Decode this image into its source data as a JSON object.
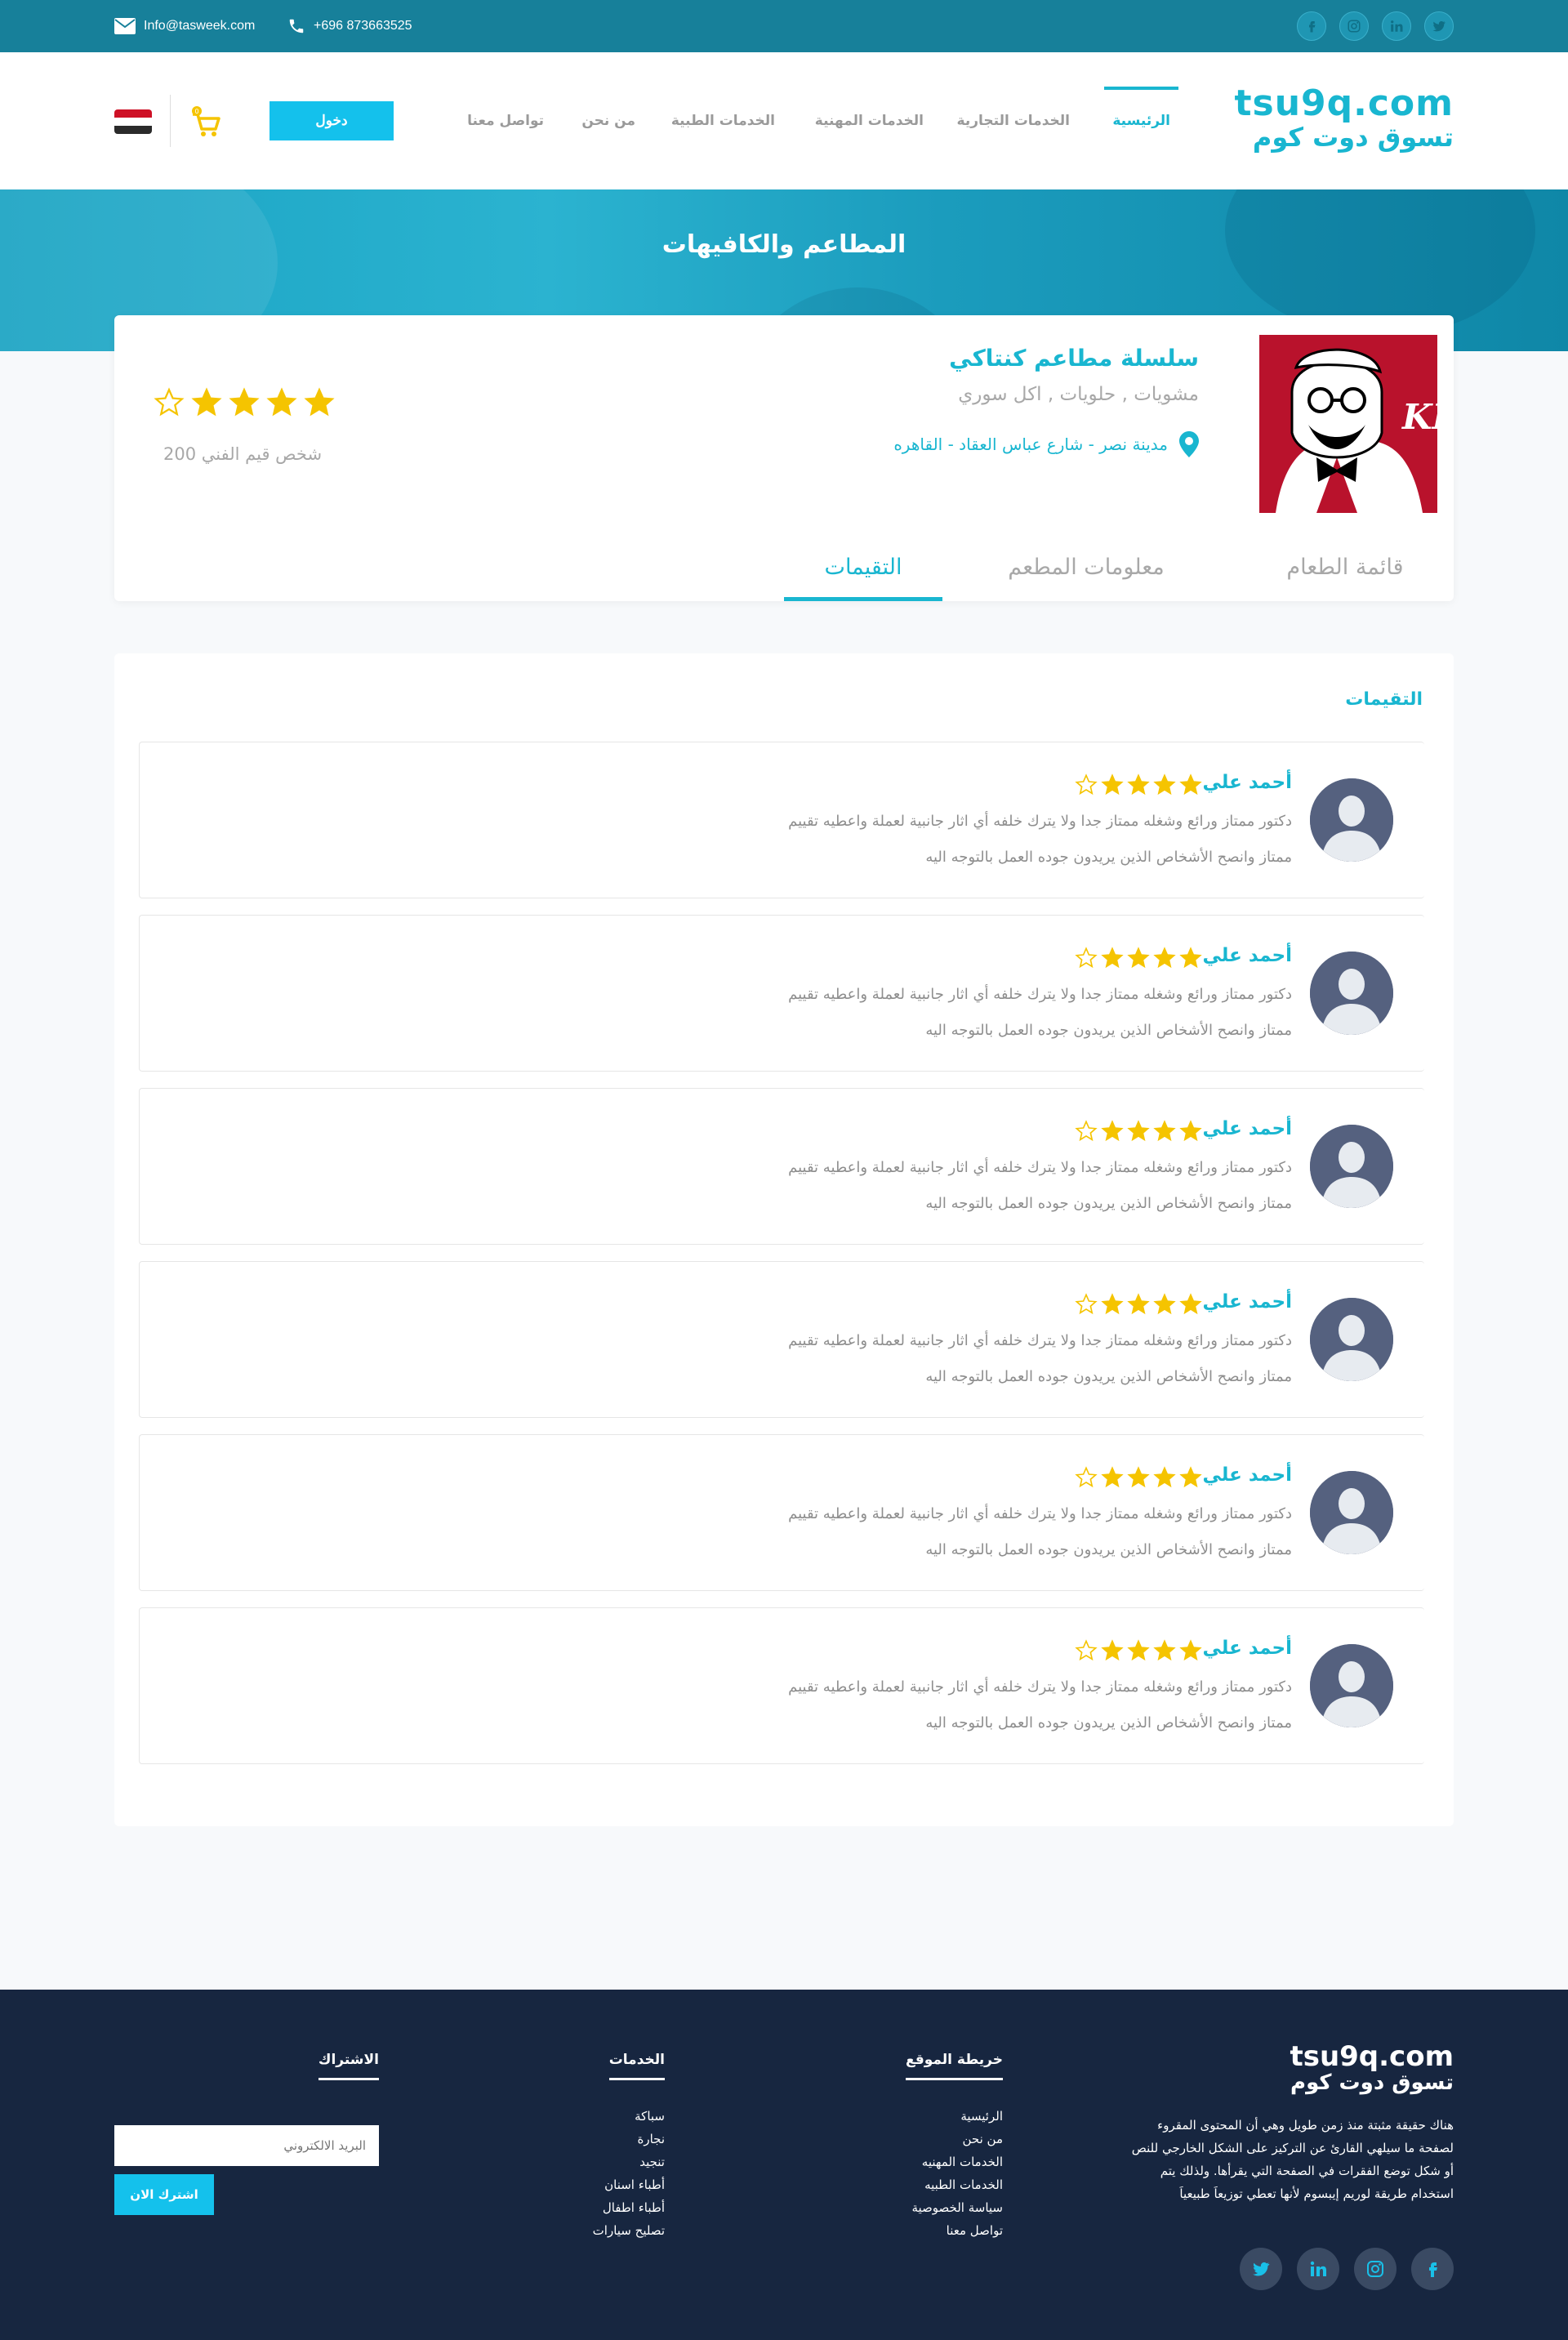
{
  "topbar": {
    "email": "Info@tasweek.com",
    "phone": "+696 873663525",
    "socials": [
      "twitter-icon",
      "linkedin-icon",
      "instagram-icon",
      "facebook-icon"
    ]
  },
  "header": {
    "logo_en": "tsu9q.com",
    "logo_ar": "تسوق دوت كوم",
    "nav": [
      {
        "label": "الرئيسية",
        "active": true
      },
      {
        "label": "الخدمات التجارية",
        "active": false
      },
      {
        "label": "الخدمات المهنية",
        "active": false
      },
      {
        "label": "الخدمات الطبية",
        "active": false
      },
      {
        "label": "من نحن",
        "active": false
      },
      {
        "label": "تواصل معنا",
        "active": false
      }
    ],
    "login_label": "دخول",
    "cart_count": "0",
    "flag": "egypt-flag-icon"
  },
  "hero": {
    "title": "المطاعم والكافيهات"
  },
  "restaurant": {
    "name": "سلسلة مطاعم كنتاكي",
    "categories": "مشويات , حلويات , اكل سوري",
    "address": "مدينة نصر - شارع عباس العقاد - القاهره",
    "logo_text": "KFC",
    "rating": 4,
    "rating_max": 5,
    "rating_count_text": "200 شخص قيم الفني"
  },
  "tabs": [
    {
      "label": "قائمة الطعام",
      "active": false
    },
    {
      "label": "معلومات المطعم",
      "active": false
    },
    {
      "label": "التقيمات",
      "active": true
    }
  ],
  "reviews": {
    "title": "التقيمات",
    "items": [
      {
        "name": "أحمد علي",
        "rating": 4,
        "line1": "دكتور ممتاز ورائع وشغله ممتاز جدا ولا يترك خلفه أي اثار جانبية لعملة واعطيه تقييم",
        "line2": "ممتاز وانصح الأشخاص الذين يريدون جوده العمل بالتوجه اليه"
      },
      {
        "name": "أحمد علي",
        "rating": 4,
        "line1": "دكتور ممتاز ورائع وشغله ممتاز جدا ولا يترك خلفه أي اثار جانبية لعملة واعطيه تقييم",
        "line2": "ممتاز وانصح الأشخاص الذين يريدون جوده العمل بالتوجه اليه"
      },
      {
        "name": "أحمد علي",
        "rating": 4,
        "line1": "دكتور ممتاز ورائع وشغله ممتاز جدا ولا يترك خلفه أي اثار جانبية لعملة واعطيه تقييم",
        "line2": "ممتاز وانصح الأشخاص الذين يريدون جوده العمل بالتوجه اليه"
      },
      {
        "name": "أحمد علي",
        "rating": 4,
        "line1": "دكتور ممتاز ورائع وشغله ممتاز جدا ولا يترك خلفه أي اثار جانبية لعملة واعطيه تقييم",
        "line2": "ممتاز وانصح الأشخاص الذين يريدون جوده العمل بالتوجه اليه"
      },
      {
        "name": "أحمد علي",
        "rating": 4,
        "line1": "دكتور ممتاز ورائع وشغله ممتاز جدا ولا يترك خلفه أي اثار جانبية لعملة واعطيه تقييم",
        "line2": "ممتاز وانصح الأشخاص الذين يريدون جوده العمل بالتوجه اليه"
      },
      {
        "name": "أحمد علي",
        "rating": 4,
        "line1": "دكتور ممتاز ورائع وشغله ممتاز جدا ولا يترك خلفه أي اثار جانبية لعملة واعطيه تقييم",
        "line2": "ممتاز وانصح الأشخاص الذين يريدون جوده العمل بالتوجه اليه"
      }
    ]
  },
  "footer": {
    "logo_en": "tsu9q.com",
    "logo_ar": "تسوق دوت كوم",
    "about": "هناك حقيقة مثبتة منذ زمن طويل وهي أن المحتوى المقروء لصفحة ما سيلهي القارئ عن التركيز على الشكل الخارجي للنص أو شكل توضع الفقرات في الصفحة التي يقرأها. ولذلك يتم استخدام طريقة لوريم إيبسوم لأنها تعطي توزيعاَ طبيعياَ",
    "sitemap": {
      "title": "خريطة الموقع",
      "links": [
        "الرئيسية",
        "من نحن",
        "الخدمات المهنيه",
        "الخدمات الطبيه",
        "سياسة الخصوصية",
        "تواصل معنا"
      ]
    },
    "services": {
      "title": "الخدمات",
      "links": [
        "سباكة",
        "نجارة",
        "تنجيد",
        "أطباء اسنان",
        "أطباء اطفال",
        "تصليح سيارات"
      ]
    },
    "subscribe": {
      "title": "الاشتراك",
      "placeholder": "البريد الالكتروني",
      "button": "اشترك الان"
    },
    "socials": [
      "twitter-icon",
      "linkedin-icon",
      "instagram-icon",
      "facebook-icon"
    ]
  },
  "colors": {
    "accent": "#19b6d0",
    "topbar": "#17809a",
    "star": "#f5c400",
    "footer": "#172640",
    "button": "#14c1ec"
  }
}
